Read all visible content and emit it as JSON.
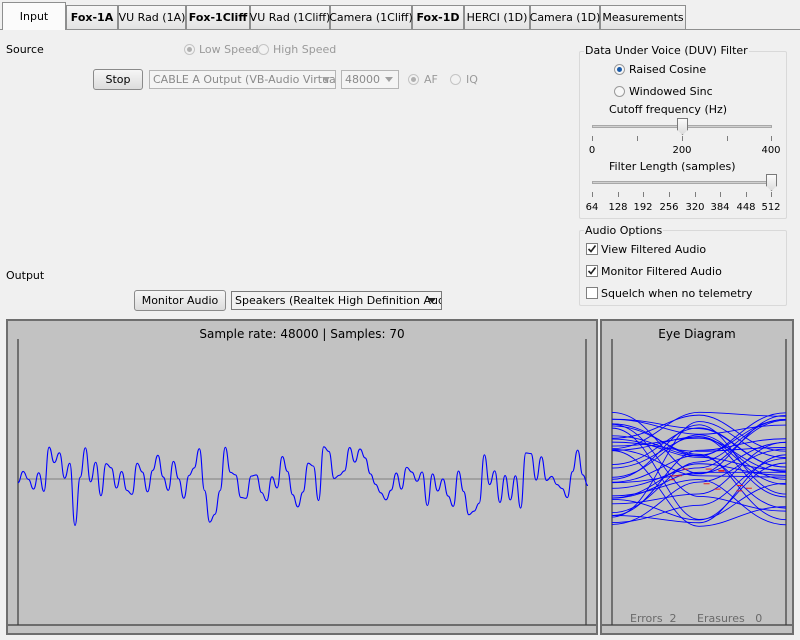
{
  "tabs": [
    {
      "label": "Input",
      "bold": false,
      "active": true
    },
    {
      "label": "Fox-1A",
      "bold": true,
      "active": false
    },
    {
      "label": "VU Rad (1A)",
      "bold": false,
      "active": false
    },
    {
      "label": "Fox-1Cliff",
      "bold": true,
      "active": false
    },
    {
      "label": "VU Rad (1Cliff)",
      "bold": false,
      "active": false
    },
    {
      "label": "Camera (1Cliff)",
      "bold": false,
      "active": false
    },
    {
      "label": "Fox-1D",
      "bold": true,
      "active": false
    },
    {
      "label": "HERCI (1D)",
      "bold": false,
      "active": false
    },
    {
      "label": "Camera (1D)",
      "bold": false,
      "active": false
    },
    {
      "label": "Measurements",
      "bold": false,
      "active": false
    }
  ],
  "source": {
    "label": "Source",
    "speed_low": "Low Speed",
    "speed_high": "High Speed",
    "speed_selected": "Low Speed",
    "stop_button": "Stop",
    "device": "CABLE A Output (VB-Audio Virtua",
    "sample_rate": "48000",
    "mode_af": "AF",
    "mode_iq": "IQ",
    "mode_selected": "AF"
  },
  "duv_filter": {
    "title": "Data Under Voice (DUV) Filter",
    "raised_cosine": "Raised Cosine",
    "windowed_sinc": "Windowed Sinc",
    "selected": "Raised Cosine",
    "cutoff_label": "Cutoff frequency (Hz)",
    "cutoff_ticks": [
      "0",
      "200",
      "400"
    ],
    "cutoff_value": 200,
    "length_label": "Filter Length (samples)",
    "length_ticks": [
      "64",
      "128",
      "192",
      "256",
      "320",
      "384",
      "448",
      "512"
    ],
    "length_value": 512
  },
  "audio_options": {
    "title": "Audio Options",
    "view_filtered": {
      "label": "View Filtered Audio",
      "checked": true
    },
    "monitor_filtered": {
      "label": "Monitor Filtered Audio",
      "checked": true
    },
    "squelch": {
      "label": "Squelch when no telemetry",
      "checked": false
    }
  },
  "output": {
    "label": "Output",
    "monitor_button": "Monitor Audio",
    "speakers": "Speakers (Realtek High Definition Audio)"
  },
  "audio_panel": {
    "title": "Sample rate: 48000 | Samples: 70",
    "waveform_color": "#0000ff",
    "background": "#c2c2c2"
  },
  "eye_panel": {
    "title": "Eye Diagram",
    "errors_label": "Errors",
    "errors_value": "2",
    "erasures_label": "Erasures",
    "erasures_value": "0"
  }
}
